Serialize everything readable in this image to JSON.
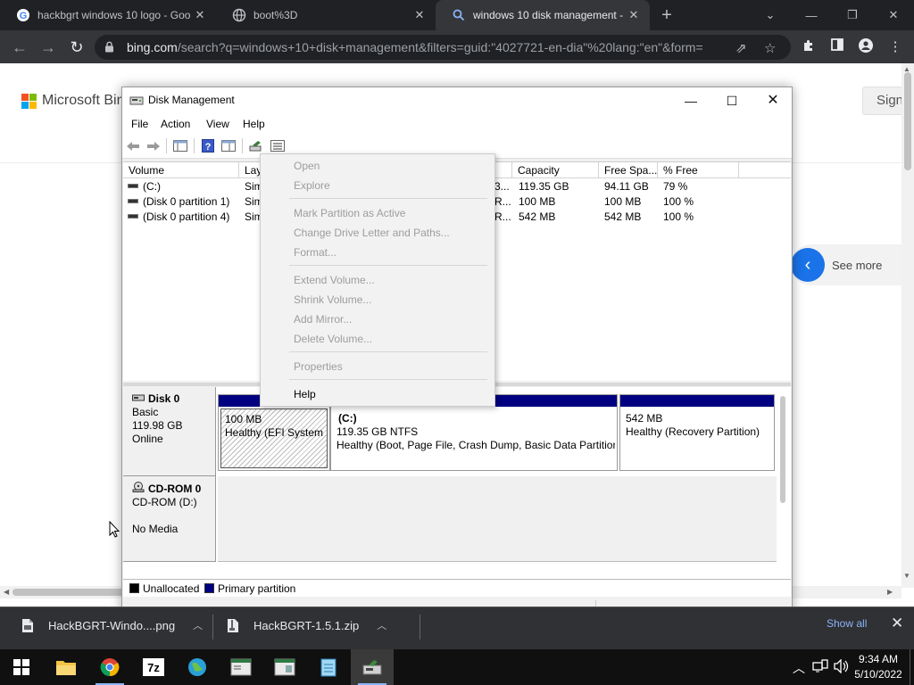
{
  "browser": {
    "tabs": [
      {
        "title": "hackbgrt windows 10 logo - Goo",
        "favicon": "google-icon"
      },
      {
        "title": "boot%3D",
        "favicon": "globe-icon"
      },
      {
        "title": "windows 10 disk management - ",
        "favicon": "search-icon",
        "active": true
      }
    ],
    "url_host": "bing.com",
    "url_rest": "/search?q=windows+10+disk+management&filters=guid:\"4027721-en-dia\"%20lang:\"en\"&form="
  },
  "bing": {
    "logo_text": "Microsoft Bing",
    "signin": "Sign",
    "see_more": "See more"
  },
  "window": {
    "title": "Disk Management",
    "menu": [
      "File",
      "Action",
      "View",
      "Help"
    ]
  },
  "volumes": {
    "columns": [
      "Volume",
      "Lay",
      "Capacity",
      "Free Spa...",
      "% Free"
    ],
    "rows": [
      {
        "volume": "(C:)",
        "layout": "Sim",
        "type_frag": "3...",
        "capacity": "119.35 GB",
        "free": "94.11 GB",
        "pct": "79 %"
      },
      {
        "volume": "(Disk 0 partition 1)",
        "layout": "Sim",
        "type_frag": "R...",
        "capacity": "100 MB",
        "free": "100 MB",
        "pct": "100 %"
      },
      {
        "volume": "(Disk 0 partition 4)",
        "layout": "Sim",
        "type_frag": "R...",
        "capacity": "542 MB",
        "free": "542 MB",
        "pct": "100 %"
      }
    ]
  },
  "context_menu": {
    "items": [
      {
        "label": "Open",
        "enabled": false
      },
      {
        "label": "Explore",
        "enabled": false
      },
      {
        "label": "Mark Partition as Active",
        "enabled": false
      },
      {
        "label": "Change Drive Letter and Paths...",
        "enabled": false
      },
      {
        "label": "Format...",
        "enabled": false
      },
      {
        "label": "Extend Volume...",
        "enabled": false
      },
      {
        "label": "Shrink Volume...",
        "enabled": false
      },
      {
        "label": "Add Mirror...",
        "enabled": false
      },
      {
        "label": "Delete Volume...",
        "enabled": false
      },
      {
        "label": "Properties",
        "enabled": false
      },
      {
        "label": "Help",
        "enabled": true
      }
    ]
  },
  "disks": {
    "disk0": {
      "name": "Disk 0",
      "type": "Basic",
      "size": "119.98 GB",
      "status": "Online"
    },
    "partitions": [
      {
        "line1": "",
        "line2": "100 MB",
        "line3": "Healthy (EFI System P"
      },
      {
        "line1": "(C:)",
        "line2": "119.35 GB NTFS",
        "line3": "Healthy (Boot, Page File, Crash Dump, Basic Data Partition)"
      },
      {
        "line1": "",
        "line2": "542 MB",
        "line3": "Healthy (Recovery Partition)"
      }
    ],
    "cdrom": {
      "name": "CD-ROM 0",
      "drive": "CD-ROM (D:)",
      "media": "No Media"
    }
  },
  "legend": {
    "unallocated": "Unallocated",
    "primary": "Primary partition",
    "unallocated_color": "#000000",
    "primary_color": "#000080"
  },
  "downloads": {
    "items": [
      "HackBGRT-Windo....png",
      "HackBGRT-1.5.1.zip"
    ],
    "show_all": "Show all"
  },
  "taskbar": {
    "time": "9:34 AM",
    "date": "5/10/2022"
  }
}
